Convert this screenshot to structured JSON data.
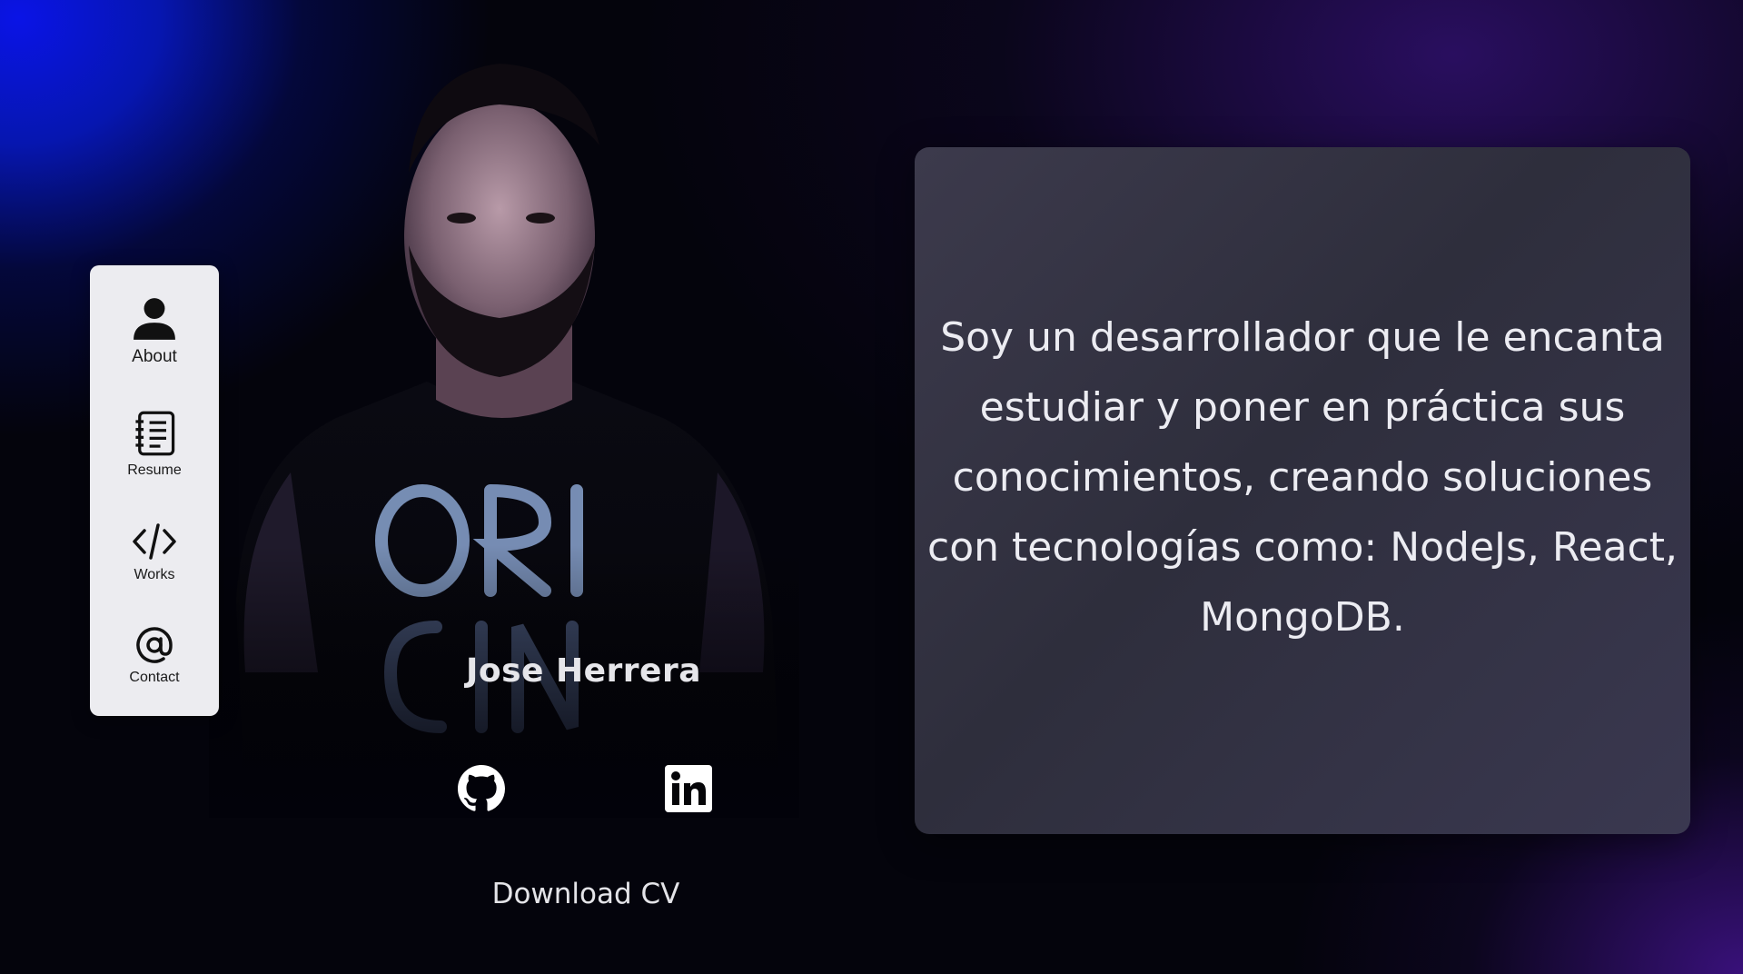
{
  "nav": {
    "items": [
      {
        "label": "About",
        "icon": "person-icon"
      },
      {
        "label": "Resume",
        "icon": "notebook-icon"
      },
      {
        "label": "Works",
        "icon": "code-icon"
      },
      {
        "label": "Contact",
        "icon": "at-icon"
      }
    ]
  },
  "profile": {
    "name": "Jose Herrera",
    "download_label": "Download CV",
    "social": [
      {
        "name": "GitHub",
        "icon": "github-icon"
      },
      {
        "name": "LinkedIn",
        "icon": "linkedin-icon"
      }
    ]
  },
  "about": {
    "text": "Soy un desarrollador que le encanta estudiar y poner en práctica sus conocimientos, creando soluciones con tecnologías como: NodeJs, React, MongoDB."
  },
  "colors": {
    "accent_blue": "#0a14e6",
    "accent_purple": "#3a1a7a",
    "sidebar_bg": "#ececf0",
    "card_bg": "#35344a"
  }
}
